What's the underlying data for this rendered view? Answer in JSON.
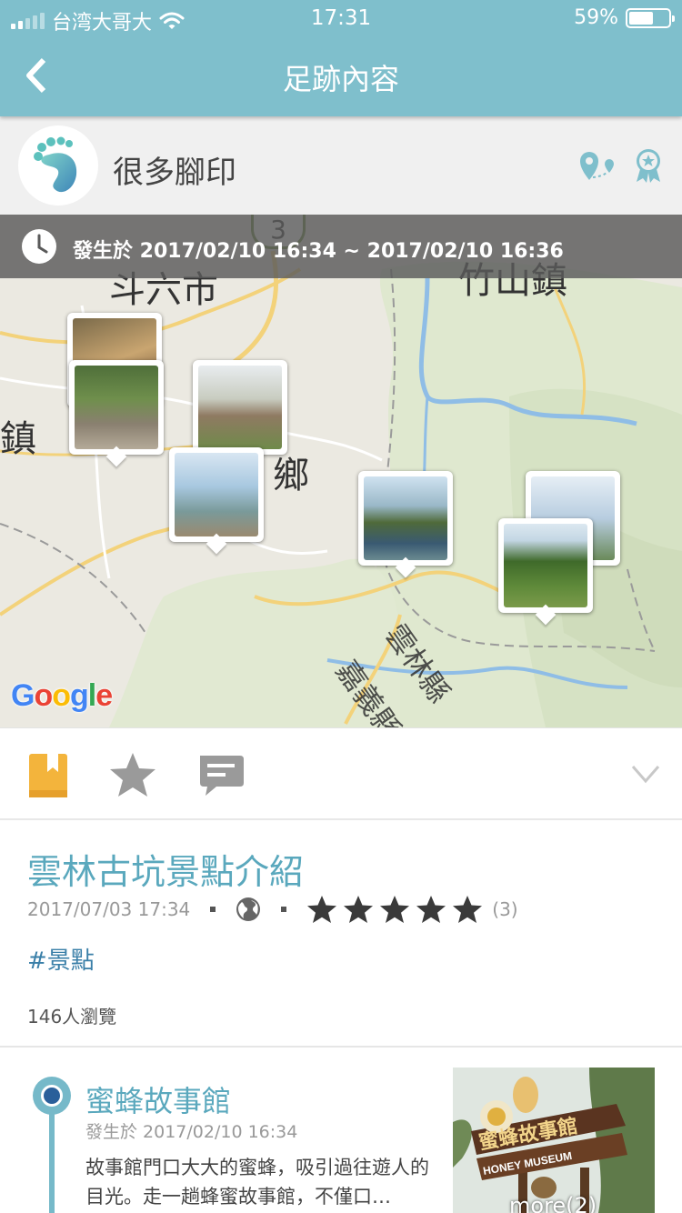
{
  "status_bar": {
    "carrier": "台湾大哥大",
    "time": "17:31",
    "battery": "59%",
    "battery_level": 0.59
  },
  "nav": {
    "title": "足跡內容",
    "back_icon": "chevron-left-icon"
  },
  "user": {
    "name": "很多腳印",
    "avatar_icon": "footprint-logo-icon",
    "actions": [
      "map-pin-icon",
      "award-icon"
    ]
  },
  "map": {
    "time_range": "發生於 2017/02/10 16:34 ~ 2017/02/10 16:36",
    "clock_icon": "clock-icon",
    "labels": {
      "doulio": "斗六市",
      "zhushan": "竹山鎮",
      "zhen": "鎮",
      "xiang": "鄉",
      "yunlin": "雲林縣",
      "chiayi": "嘉義縣",
      "road_number": "3"
    },
    "google_logo": "Google"
  },
  "tabs": [
    {
      "icon": "bookmark-book-icon",
      "active": true
    },
    {
      "icon": "star-icon",
      "active": false
    },
    {
      "icon": "comment-icon",
      "active": false
    },
    {
      "icon": "chevron-down-icon",
      "active": false
    }
  ],
  "article": {
    "title": "雲林古坑景點介紹",
    "date": "2017/07/03 17:34",
    "visibility_icon": "globe-icon",
    "rating": 5,
    "rating_count": "(3)",
    "tag": "#景點",
    "views": "146人瀏覽"
  },
  "spot": {
    "title": "蜜蜂故事館",
    "time": "發生於 2017/02/10 16:34",
    "description": "故事館門口大大的蜜蜂，吸引過往遊人的目光。走一趟蜂蜜故事館，不僅口…",
    "photo_sign": "蜜蜂故事館",
    "photo_sign_en": "HONEY MUSEUM",
    "more": "more(2)"
  },
  "colors": {
    "header": "#7fbfcc",
    "accent_text": "#5aa8bd",
    "bookmark": "#f3b43c",
    "tag": "#3a7fa8"
  }
}
